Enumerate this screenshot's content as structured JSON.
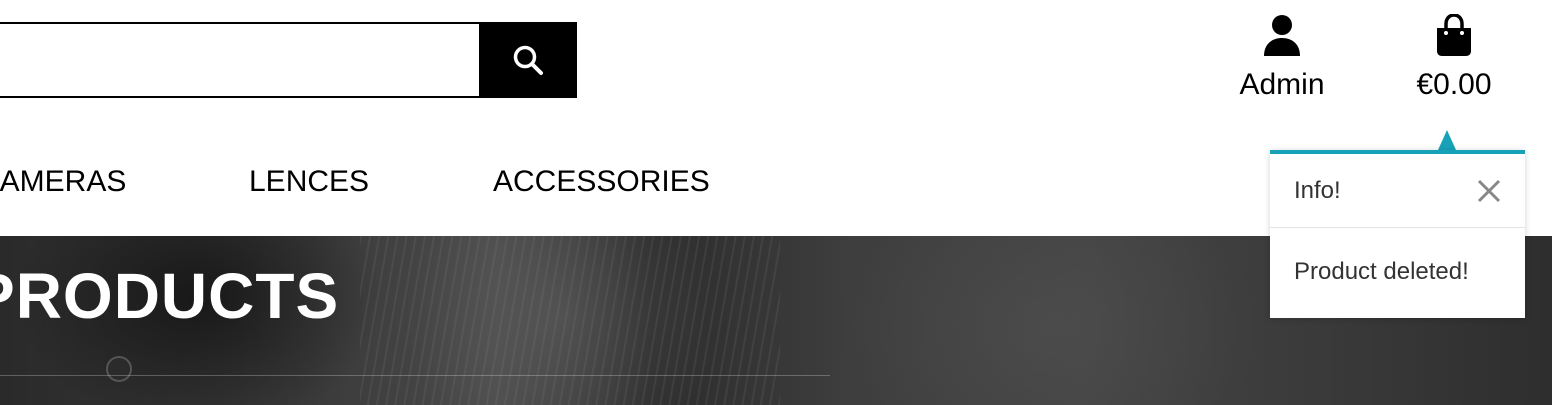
{
  "search": {
    "placeholder": "",
    "value": "",
    "button_icon": "search-icon"
  },
  "header": {
    "account": {
      "icon": "user-icon",
      "label": "Admin"
    },
    "cart": {
      "icon": "shopping-bag-icon",
      "label": "€0.00"
    }
  },
  "nav": {
    "items": [
      {
        "label": "CAMERAS"
      },
      {
        "label": "LENCES"
      },
      {
        "label": "ACCESSORIES"
      }
    ]
  },
  "hero": {
    "title": "PRODUCTS"
  },
  "toast": {
    "title": "Info!",
    "message": "Product deleted!",
    "accent_color": "#17a2b8",
    "close_icon": "close-icon"
  }
}
